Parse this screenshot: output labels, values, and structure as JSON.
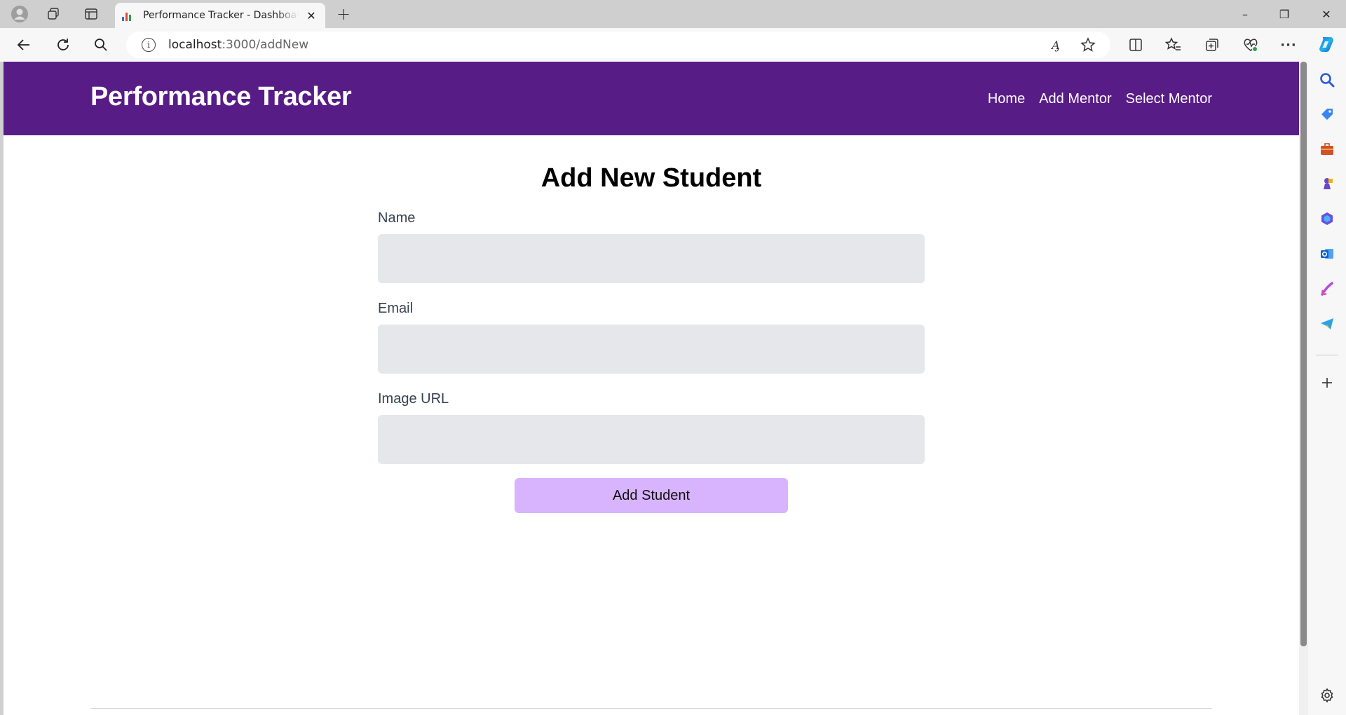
{
  "browser": {
    "tab_title": "Performance Tracker - Dashboard",
    "tab_favicon": "bar-chart-icon",
    "url_host": "localhost",
    "url_path": ":3000/addNew",
    "controls": {
      "minimize": "–",
      "restore": "❐",
      "close": "✕",
      "new_tab": "+"
    },
    "toolbar_icons": [
      "back-arrow-icon",
      "refresh-icon",
      "search-icon",
      "info-icon",
      "read-aloud-icon",
      "favorite-star-icon",
      "split-screen-icon",
      "favorites-icon",
      "collections-icon",
      "browser-essentials-icon",
      "more-icon",
      "copilot-icon"
    ],
    "read_aloud_glyph": "A̡",
    "more_glyph": "···",
    "sidebar_icons": [
      "search-icon",
      "shopping-tag-icon",
      "tools-briefcase-icon",
      "games-icon",
      "microsoft-365-icon",
      "outlook-icon",
      "designer-icon",
      "telegram-icon",
      "add-icon",
      "settings-icon"
    ],
    "colors": {
      "chrome_bg": "#cfcfcf",
      "toolbar_bg": "#f7f7f7"
    }
  },
  "site": {
    "brand": "Performance Tracker",
    "nav": {
      "home": "Home",
      "add_mentor": "Add Mentor",
      "select_mentor": "Select Mentor"
    },
    "colors": {
      "header": "#581c87",
      "input_bg": "#e5e7eb",
      "button_bg": "#d8b4fe"
    }
  },
  "form": {
    "title": "Add New Student",
    "fields": [
      {
        "label": "Name",
        "value": "",
        "placeholder": ""
      },
      {
        "label": "Email",
        "value": "",
        "placeholder": ""
      },
      {
        "label": "Image URL",
        "value": "",
        "placeholder": ""
      }
    ],
    "submit_label": "Add Student"
  }
}
